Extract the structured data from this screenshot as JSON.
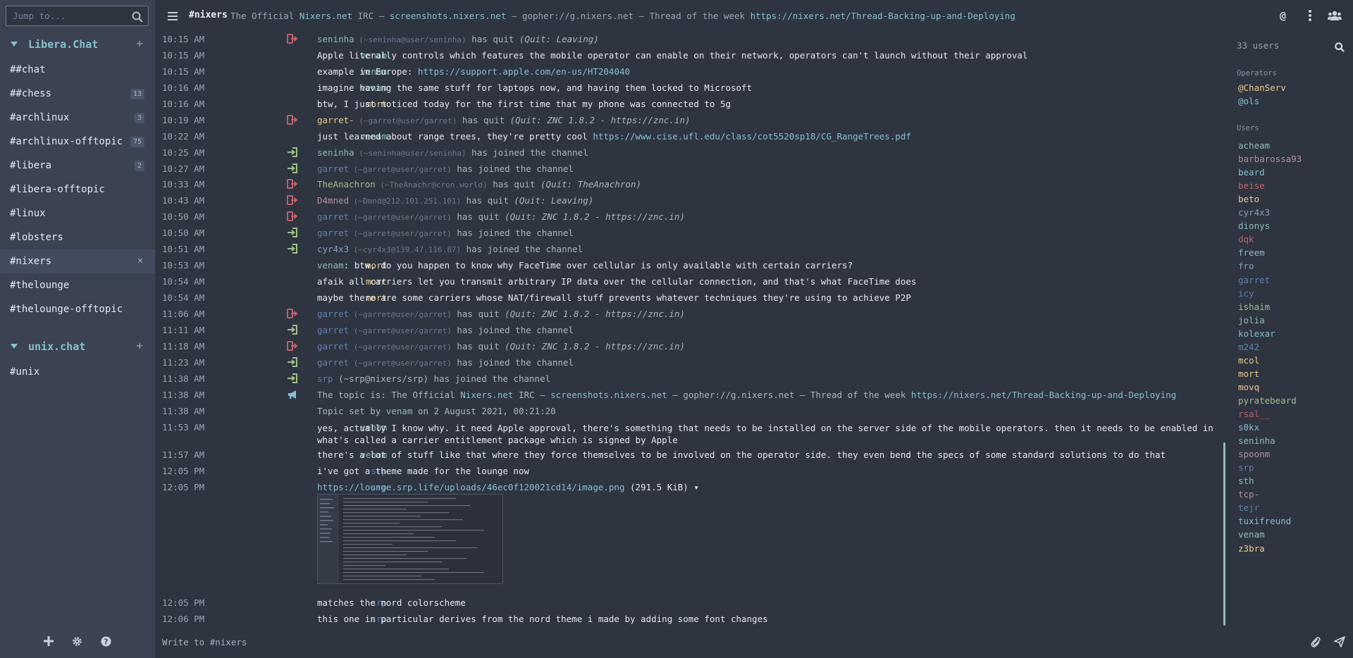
{
  "sidebar": {
    "search_placeholder": "Jump to...",
    "networks": [
      {
        "name": "Libera.Chat",
        "channels": [
          {
            "name": "##chat",
            "badge": ""
          },
          {
            "name": "##chess",
            "badge": "13"
          },
          {
            "name": "#archlinux",
            "badge": "3"
          },
          {
            "name": "#archlinux-offtopic",
            "badge": "75"
          },
          {
            "name": "#libera",
            "badge": "2"
          },
          {
            "name": "#libera-offtopic",
            "badge": ""
          },
          {
            "name": "#linux",
            "badge": ""
          },
          {
            "name": "#lobsters",
            "badge": ""
          },
          {
            "name": "#nixers",
            "badge": "",
            "active": true
          },
          {
            "name": "#thelounge",
            "badge": ""
          },
          {
            "name": "#thelounge-offtopic",
            "badge": ""
          }
        ]
      },
      {
        "name": "unix.chat",
        "channels": [
          {
            "name": "#unix",
            "badge": ""
          }
        ]
      }
    ],
    "close_glyph": "×",
    "footer_icons": [
      "plus-icon",
      "gear-icon",
      "help-icon"
    ]
  },
  "header": {
    "channel": "#nixers",
    "topic_parts": [
      {
        "t": "The Official ",
        "c": ""
      },
      {
        "t": "Nixers.net",
        "c": "link"
      },
      {
        "t": " IRC — ",
        "c": ""
      },
      {
        "t": "screenshots.nixers.net",
        "c": "link"
      },
      {
        "t": " — gopher://g.nixers.net — Thread of the week ",
        "c": ""
      },
      {
        "t": "https://nixers.net/Thread-Backing-up-and-Deploying",
        "c": "link"
      }
    ],
    "icons": [
      "mention-icon",
      "more-vertical-icon",
      "users-icon"
    ]
  },
  "messages": [
    {
      "time": "10:15 AM",
      "kind": "quit",
      "parts": [
        {
          "t": "seninha",
          "c": "nick-seninha"
        },
        {
          "t": " (~seninha@user/seninha)",
          "c": "host"
        },
        {
          "t": " has quit "
        },
        {
          "t": "(Quit: Leaving)",
          "c": "quitmsg"
        }
      ]
    },
    {
      "time": "10:15 AM",
      "from": "venam",
      "parts": [
        {
          "t": "Apple literally controls which features the mobile operator can enable on their network, operators can't launch without their approval"
        }
      ]
    },
    {
      "time": "10:15 AM",
      "from": "venam",
      "parts": [
        {
          "t": "example in Europe: "
        },
        {
          "t": "https://support.apple.com/en-us/HT204040",
          "c": "link"
        }
      ]
    },
    {
      "time": "10:16 AM",
      "from": "venam",
      "parts": [
        {
          "t": "imagine having the same stuff for laptops now, and having them locked to Microsoft"
        }
      ]
    },
    {
      "time": "10:16 AM",
      "from": "mort",
      "parts": [
        {
          "t": "btw, I just noticed today for the first time that my phone was connected to 5g"
        }
      ]
    },
    {
      "time": "10:19 AM",
      "kind": "quit",
      "parts": [
        {
          "t": "garret-",
          "c": "nick-mort"
        },
        {
          "t": " (~garret@user/garret)",
          "c": "host"
        },
        {
          "t": " has quit "
        },
        {
          "t": "(Quit: ZNC 1.8.2 - https://znc.in)",
          "c": "quitmsg"
        }
      ]
    },
    {
      "time": "10:22 AM",
      "from": "venam",
      "parts": [
        {
          "t": "just learned about range trees, they're pretty cool "
        },
        {
          "t": "https://www.cise.ufl.edu/class/cot5520sp18/CG_RangeTrees.pdf",
          "c": "link"
        }
      ]
    },
    {
      "time": "10:25 AM",
      "kind": "join",
      "parts": [
        {
          "t": "seninha",
          "c": "nick-seninha"
        },
        {
          "t": " (~seninha@user/seninha)",
          "c": "host"
        },
        {
          "t": " has joined the channel"
        }
      ]
    },
    {
      "time": "10:27 AM",
      "kind": "join",
      "parts": [
        {
          "t": "garret",
          "c": "nick-garret"
        },
        {
          "t": " (~garret@user/garret)",
          "c": "host"
        },
        {
          "t": " has joined the channel"
        }
      ]
    },
    {
      "time": "10:33 AM",
      "kind": "quit",
      "parts": [
        {
          "t": "TheAnachron",
          "c": "nick-ishaim"
        },
        {
          "t": " (~TheAnachr@cron.world)",
          "c": "host"
        },
        {
          "t": " has quit "
        },
        {
          "t": "(Quit: TheAnachron)",
          "c": "quitmsg"
        }
      ]
    },
    {
      "time": "10:43 AM",
      "kind": "quit",
      "parts": [
        {
          "t": "D4mned",
          "c": "nick-spoonm"
        },
        {
          "t": " (~Dmnd@212.101.251.101)",
          "c": "host"
        },
        {
          "t": " has quit "
        },
        {
          "t": "(Quit: Leaving)",
          "c": "quitmsg"
        }
      ]
    },
    {
      "time": "10:50 AM",
      "kind": "quit",
      "parts": [
        {
          "t": "garret",
          "c": "nick-garret"
        },
        {
          "t": " (~garret@user/garret)",
          "c": "host"
        },
        {
          "t": " has quit "
        },
        {
          "t": "(Quit: ZNC 1.8.2 - https://znc.in)",
          "c": "quitmsg"
        }
      ]
    },
    {
      "time": "10:50 AM",
      "kind": "join",
      "parts": [
        {
          "t": "garret",
          "c": "nick-garret"
        },
        {
          "t": " (~garret@user/garret)",
          "c": "host"
        },
        {
          "t": " has joined the channel"
        }
      ]
    },
    {
      "time": "10:51 AM",
      "kind": "join",
      "parts": [
        {
          "t": "cyr4x3",
          "c": "nick-cyr4x3"
        },
        {
          "t": " (~cyr4x3@139.47.116.87)",
          "c": "host"
        },
        {
          "t": " has joined the channel"
        }
      ]
    },
    {
      "time": "10:53 AM",
      "from": "mort",
      "parts": [
        {
          "t": "venam",
          "c": "nick-venam"
        },
        {
          "t": ": btw, do you happen to know why FaceTime over cellular is only available with certain carriers?"
        }
      ]
    },
    {
      "time": "10:54 AM",
      "from": "mort",
      "parts": [
        {
          "t": "afaik all carriers let you transmit arbitrary IP data over the cellular connection, and that's what FaceTime does"
        }
      ]
    },
    {
      "time": "10:54 AM",
      "from": "mort",
      "parts": [
        {
          "t": "maybe there are some carriers whose NAT/firewall stuff prevents whatever techniques they're using to achieve P2P"
        }
      ]
    },
    {
      "time": "11:06 AM",
      "kind": "quit",
      "parts": [
        {
          "t": "garret",
          "c": "nick-garret"
        },
        {
          "t": " (~garret@user/garret)",
          "c": "host"
        },
        {
          "t": " has quit "
        },
        {
          "t": "(Quit: ZNC 1.8.2 - https://znc.in)",
          "c": "quitmsg"
        }
      ]
    },
    {
      "time": "11:11 AM",
      "kind": "join",
      "parts": [
        {
          "t": "garret",
          "c": "nick-garret"
        },
        {
          "t": " (~garret@user/garret)",
          "c": "host"
        },
        {
          "t": " has joined the channel"
        }
      ]
    },
    {
      "time": "11:18 AM",
      "kind": "quit",
      "parts": [
        {
          "t": "garret",
          "c": "nick-garret"
        },
        {
          "t": " (~garret@user/garret)",
          "c": "host"
        },
        {
          "t": " has quit "
        },
        {
          "t": "(Quit: ZNC 1.8.2 - https://znc.in)",
          "c": "quitmsg"
        }
      ]
    },
    {
      "time": "11:23 AM",
      "kind": "join",
      "parts": [
        {
          "t": "garret",
          "c": "nick-garret"
        },
        {
          "t": " (~garret@user/garret)",
          "c": "host"
        },
        {
          "t": " has joined the channel"
        }
      ]
    },
    {
      "time": "11:38 AM",
      "kind": "join",
      "parts": [
        {
          "t": "srp",
          "c": "nick-srp"
        },
        {
          "t": " (~srp@nixers/srp)"
        },
        {
          "t": " has joined the channel"
        }
      ]
    },
    {
      "time": "11:38 AM",
      "kind": "topic",
      "parts": [
        {
          "t": "The topic is: The Official "
        },
        {
          "t": "Nixers.net",
          "c": "link"
        },
        {
          "t": " IRC — "
        },
        {
          "t": "screenshots.nixers.net",
          "c": "link"
        },
        {
          "t": " — gopher://g.nixers.net — Thread of the week "
        },
        {
          "t": "https://nixers.net/Thread-Backing-up-and-Deploying",
          "c": "link"
        }
      ]
    },
    {
      "time": "11:38 AM",
      "kind": "topicset",
      "parts": [
        {
          "t": "Topic set by "
        },
        {
          "t": "venam",
          "c": "nick-venam"
        },
        {
          "t": " on 2 August 2021, 00:21:20"
        }
      ]
    },
    {
      "time": "11:53 AM",
      "from": "venam",
      "wrap": true,
      "parts": [
        {
          "t": "yes, actually I know why. it need Apple approval, there's something that needs to be installed on the server side of the mobile operators. then it needs to be enabled in what's called a carrier entitlement package which is signed by Apple"
        }
      ]
    },
    {
      "time": "11:57 AM",
      "from": "venam",
      "parts": [
        {
          "t": "there's a lot of stuff like that where they force themselves to be involved on the operator side. they even bend the specs of some standard solutions to do that"
        }
      ]
    },
    {
      "time": "12:05 PM",
      "from": "srp",
      "parts": [
        {
          "t": "i've got a theme made for the lounge now"
        }
      ]
    },
    {
      "time": "12:05 PM",
      "from": "srp",
      "parts": [
        {
          "t": "https://lounge.srp.life/uploads/46ec0f120021cd14/image.png",
          "c": "link"
        },
        {
          "t": " (291.5 KiB) ▾"
        }
      ]
    },
    {
      "time": "12:05 PM",
      "from": "srp",
      "parts": [
        {
          "t": "matches the nord colorscheme"
        }
      ]
    },
    {
      "time": "12:06 PM",
      "from": "srp",
      "parts": [
        {
          "t": "this one in particular derives from the nord theme i made by adding some font changes"
        }
      ]
    }
  ],
  "userlist": {
    "count_label": "33 users",
    "operators_label": "Operators",
    "operators": [
      "@ChanServ",
      "@ols"
    ],
    "users_label": "Users",
    "users": [
      "acheam",
      "barbarossa93",
      "beard",
      "beise",
      "beto",
      "cyr4x3",
      "dionys",
      "dqk",
      "freem",
      "fro",
      "garret",
      "icy",
      "ishaim",
      "jolia",
      "kolexar",
      "m242",
      "mcol",
      "mort",
      "movq",
      "pyratebeard",
      "rsal__",
      "s0kx",
      "seninha",
      "spoonm",
      "srp",
      "sth",
      "tcp-",
      "tejr",
      "tuxifreund",
      "venam",
      "z3bra"
    ]
  },
  "composer": {
    "placeholder": "Write to #nixers",
    "icons": [
      "paperclip-icon",
      "send-icon"
    ]
  },
  "colors": {
    "background": "#2e3440",
    "sidebar": "#3b4252",
    "accent": "#88c0d0",
    "quit": "#bf616a",
    "join": "#a3be8c",
    "nicks": {
      "acheam": "#8fbcbb",
      "barbarossa93": "#b48ead",
      "beard": "#88c0d0",
      "beise": "#bf616a",
      "beto": "#ebcb8b",
      "cyr4x3": "#81a1c1",
      "dionys": "#8fbcbb",
      "dqk": "#bf616a",
      "freem": "#8fbcbb",
      "fro": "#81a1c1",
      "garret": "#5e81ac",
      "icy": "#5e81ac",
      "ishaim": "#a3be8c",
      "jolia": "#8fbcbb",
      "kolexar": "#88c0d0",
      "m242": "#5e81ac",
      "mcol": "#ebcb8b",
      "mort": "#ebcb8b",
      "movq": "#ebcb8b",
      "pyratebeard": "#a3be8c",
      "rsal__": "#bf616a",
      "s0kx": "#88c0d0",
      "seninha": "#8fbcbb",
      "spoonm": "#b48ead",
      "srp": "#5e81ac",
      "sth": "#8fbcbb",
      "tcp-": "#b48ead",
      "tejr": "#5e81ac",
      "tuxifreund": "#88c0d0",
      "venam": "#8fbcbb",
      "z3bra": "#ebcb8b",
      "@ChanServ": "#ebcb8b",
      "@ols": "#88c0d0"
    }
  }
}
